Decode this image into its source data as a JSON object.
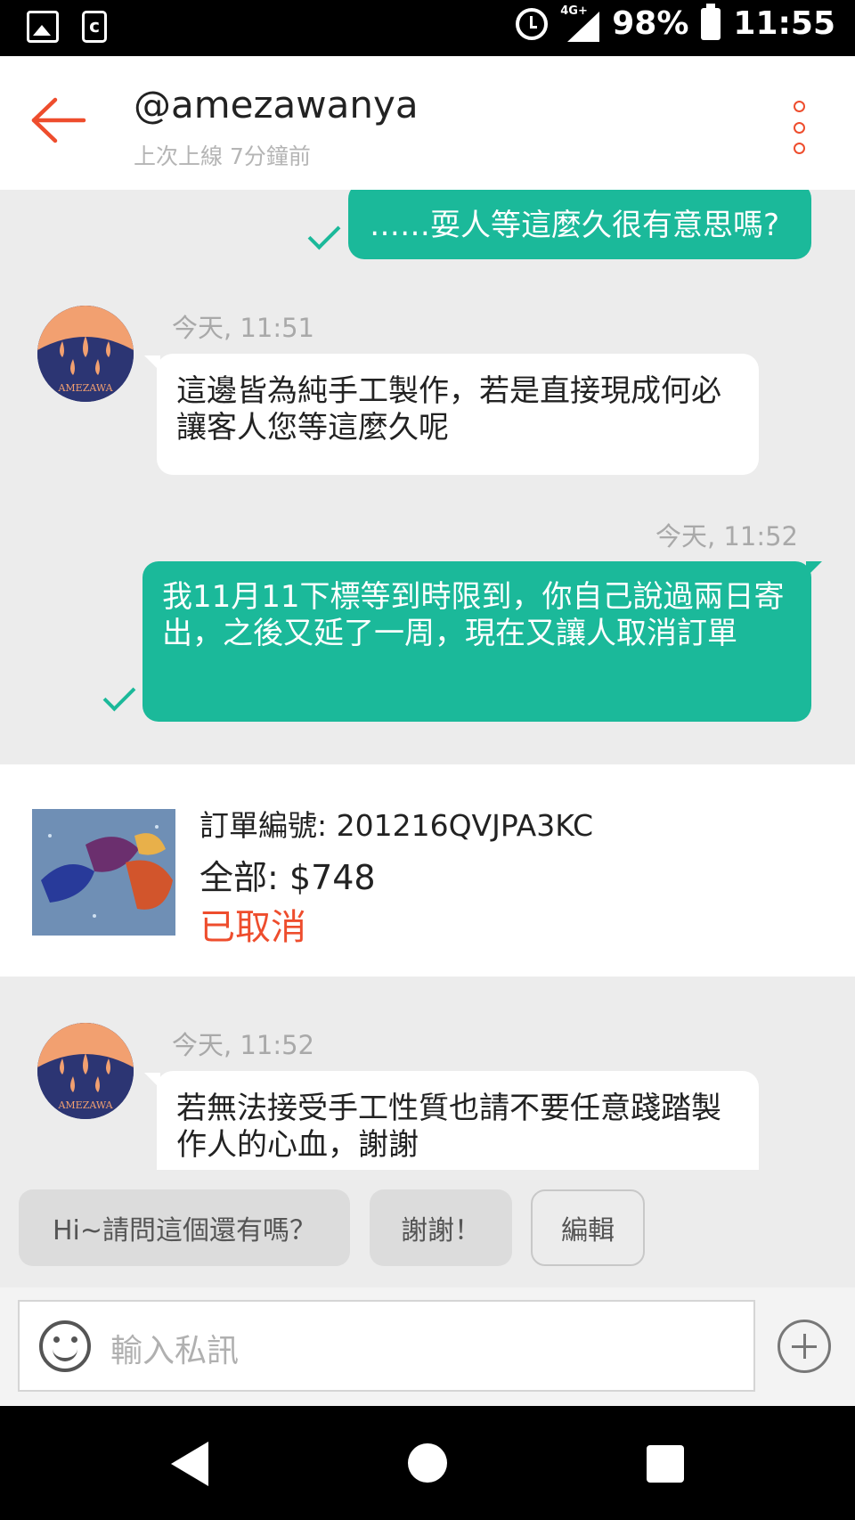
{
  "status_bar": {
    "network": "4G+",
    "battery": "98%",
    "time": "11:55",
    "icons": [
      "gallery-icon",
      "phone-app-icon",
      "alarm-icon",
      "signal-icon",
      "battery-icon"
    ]
  },
  "header": {
    "username": "@amezawanya",
    "last_seen": "上次上線 7分鐘前"
  },
  "messages": [
    {
      "direction": "out",
      "text": "……耍人等這麼久很有意思嗎?",
      "read": true
    },
    {
      "direction": "in",
      "timestamp": "今天, 11:51",
      "text": "這邊皆為純手工製作，若是直接現成何必讓客人您等這麼久呢",
      "avatar_text": "AMEZAWA"
    },
    {
      "direction": "out",
      "timestamp": "今天, 11:52",
      "text": "我11月11下標等到時限到，你自己說過兩日寄出，之後又延了一周，現在又讓人取消訂單",
      "read": true
    },
    {
      "direction": "in",
      "timestamp": "今天, 11:52",
      "text": "若無法接受手工性質也請不要任意踐踏製作人的心血，謝謝",
      "avatar_text": "AMEZAWA"
    }
  ],
  "order": {
    "id_label": "訂單編號: 201216QVJPA3KC",
    "total_label": "全部:",
    "total_value": "$748",
    "status": "已取消"
  },
  "quick_replies": [
    "Hi~請問這個還有嗎？",
    "謝謝！",
    "編輯"
  ],
  "input": {
    "placeholder": "輸入私訊"
  },
  "colors": {
    "accent": "#ee4d2d",
    "bubble_out": "#1bb99a",
    "background": "#ececec"
  }
}
